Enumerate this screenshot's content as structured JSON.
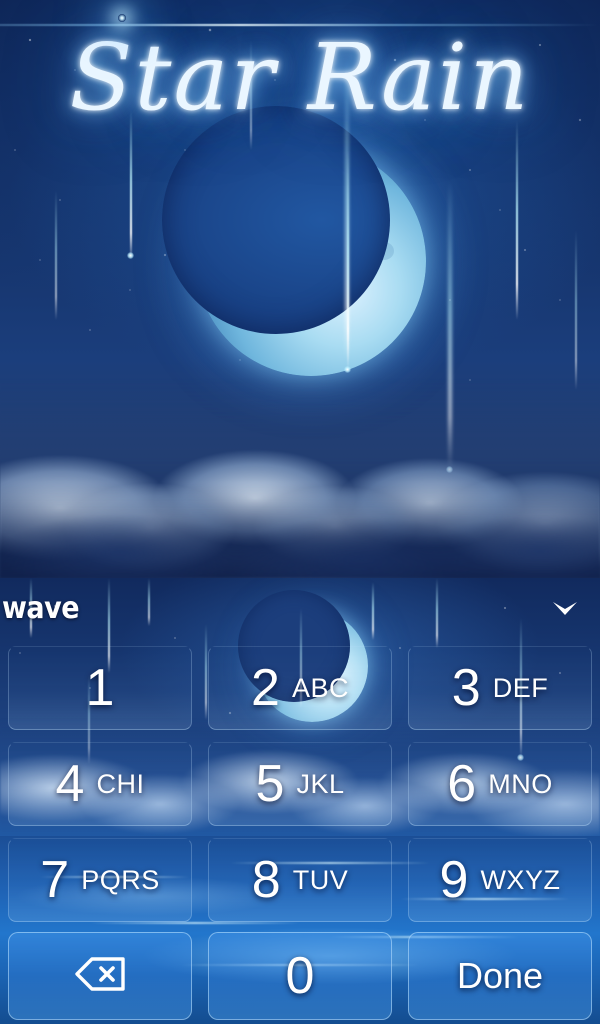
{
  "app": {
    "theme_name": "Star Rain",
    "type": "keyboard-theme-preview"
  },
  "preview": {
    "title": "Star Rain"
  },
  "keyboard": {
    "suggestion": {
      "word": "wave"
    },
    "hide_keyboard_icon": "chevron-down-icon",
    "rows": [
      [
        {
          "digit": "1",
          "letters": ""
        },
        {
          "digit": "2",
          "letters": "ABC"
        },
        {
          "digit": "3",
          "letters": "DEF"
        }
      ],
      [
        {
          "digit": "4",
          "letters": "CHI"
        },
        {
          "digit": "5",
          "letters": "JKL"
        },
        {
          "digit": "6",
          "letters": "MNO"
        }
      ],
      [
        {
          "digit": "7",
          "letters": "PQRS"
        },
        {
          "digit": "8",
          "letters": "TUV"
        },
        {
          "digit": "9",
          "letters": "WXYZ"
        }
      ]
    ],
    "bottom_row": {
      "backspace_icon": "backspace-icon",
      "zero": "0",
      "done_label": "Done"
    }
  },
  "colors": {
    "sky_deep": "#0a1c48",
    "sky_mid": "#1b3e7c",
    "keyboard_top": "#112a5e",
    "keyboard_water": "#2276cc",
    "accent_glow": "#9ad8ff",
    "key_text": "#ffffff"
  }
}
